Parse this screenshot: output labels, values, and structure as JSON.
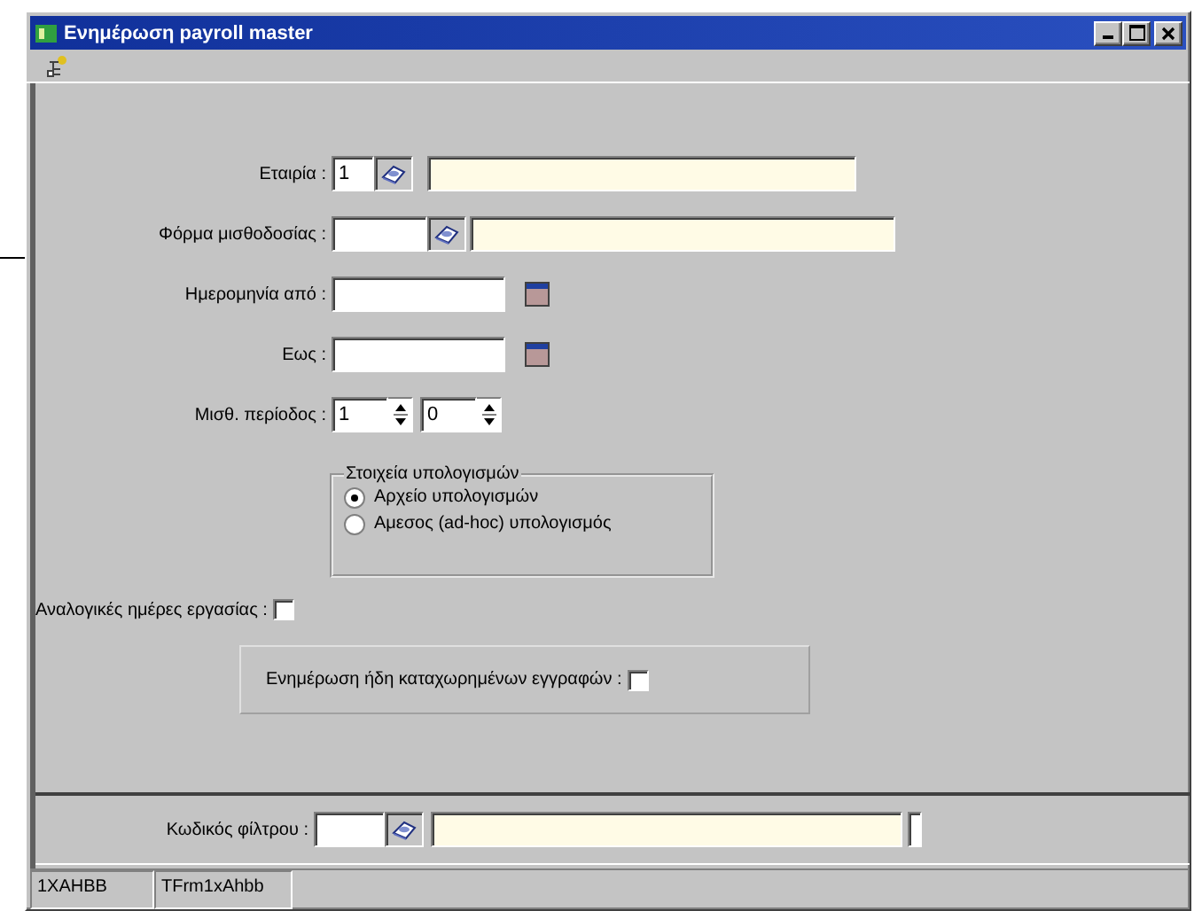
{
  "window": {
    "title": "Ενημέρωση payroll master"
  },
  "fields": [
    {
      "kind": "lookup",
      "label": "Εταιρία :",
      "value": "1"
    },
    {
      "kind": "lookup",
      "label": "Φόρμα μισθοδοσίας :"
    },
    {
      "kind": "date",
      "label": "Ημερομηνία από :"
    },
    {
      "kind": "date",
      "label": "Εως :"
    },
    {
      "kind": "spin_pair",
      "label": "Μισθ. περίοδος :",
      "values": [
        "1",
        "0"
      ]
    }
  ],
  "calculation_group": {
    "title": "Στοιχεία υπολογισμών",
    "options": [
      {
        "label": "Αρχείο υπολογισμών",
        "selected": true
      },
      {
        "label": "Αμεσος (ad-hoc) υπολογισμός",
        "selected": false
      }
    ]
  },
  "proportional_days": {
    "label": "Αναλογικές ημέρες εργασίας :",
    "checked": false
  },
  "update_registered": {
    "label": "Ενημέρωση ήδη καταχωρημένων εγγραφών :",
    "checked": false
  },
  "filter": {
    "label": "Κωδικός φίλτρου :"
  },
  "status_bar": [
    "1XAHBB",
    "TFrm1xAhbb"
  ]
}
